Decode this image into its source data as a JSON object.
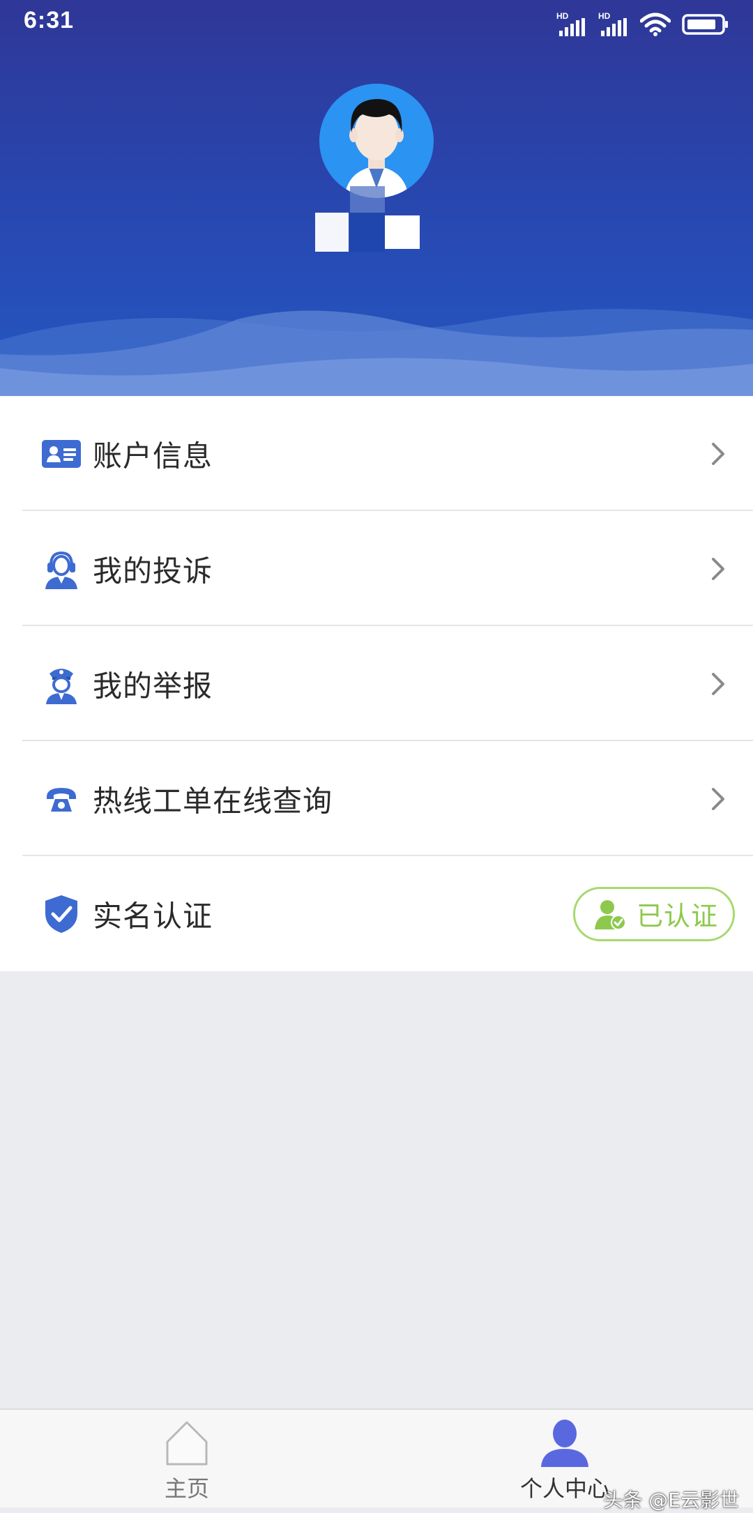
{
  "status_bar": {
    "time": "6:31",
    "network_labels": [
      "HD",
      "HD"
    ]
  },
  "profile": {
    "nickname": ""
  },
  "menu": {
    "items": [
      {
        "label": "账户信息",
        "icon": "id-card-icon"
      },
      {
        "label": "我的投诉",
        "icon": "service-agent-icon"
      },
      {
        "label": "我的举报",
        "icon": "police-officer-icon"
      },
      {
        "label": "热线工单在线查询",
        "icon": "telephone-icon"
      },
      {
        "label": "实名认证",
        "icon": "shield-check-icon",
        "badge": "已认证"
      }
    ]
  },
  "tabbar": {
    "tabs": [
      {
        "label": "主页",
        "icon": "home-icon",
        "active": false
      },
      {
        "label": "个人中心",
        "icon": "user-icon",
        "active": true
      }
    ]
  },
  "watermark": "头条 @E云影世",
  "colors": {
    "header_top": "#2f3797",
    "header_bottom": "#2457c2",
    "icon_blue": "#3d6bd1",
    "verified_green": "#8cc94c",
    "page_bg": "#ebecef"
  }
}
